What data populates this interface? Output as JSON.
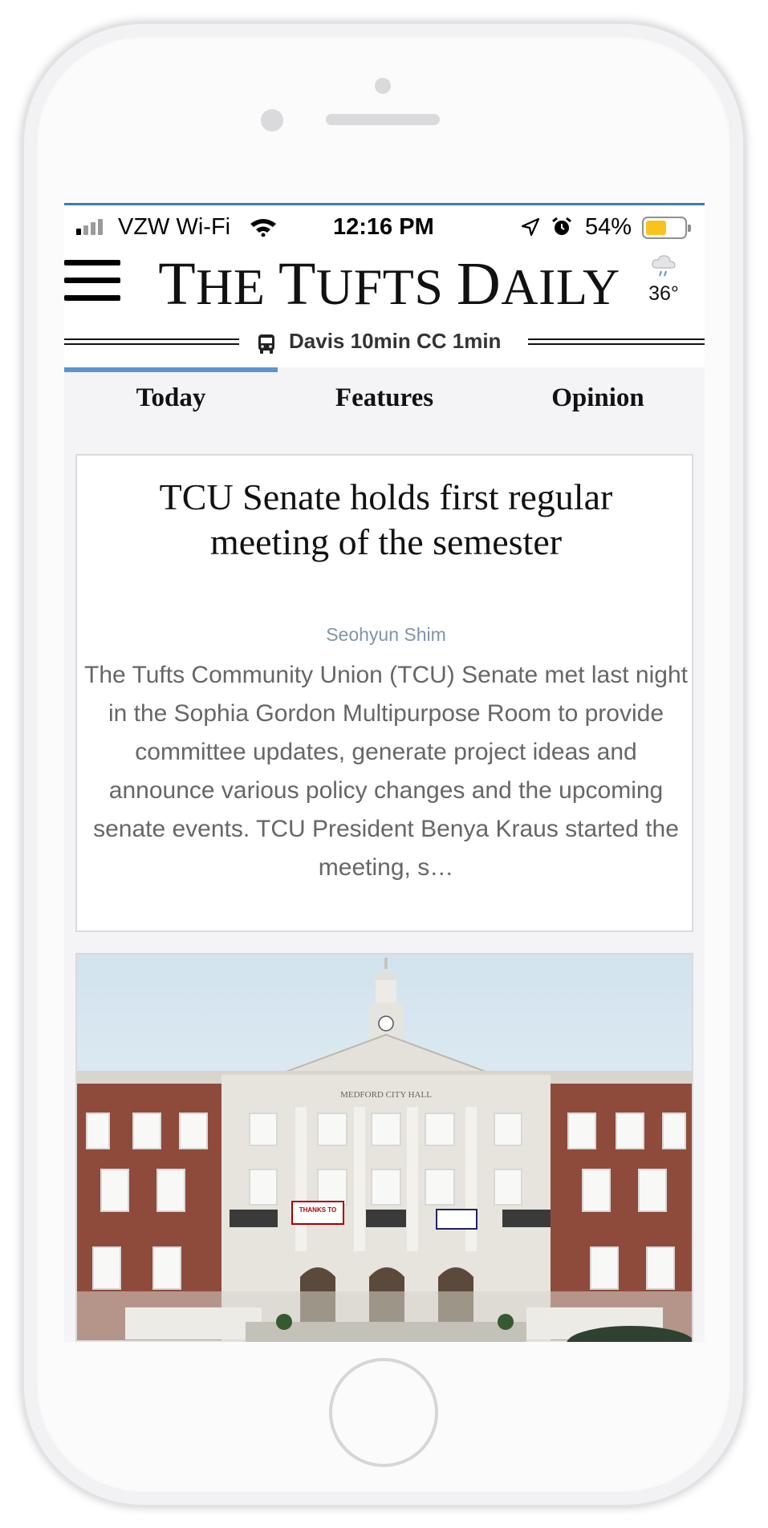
{
  "status_bar": {
    "carrier": "VZW Wi-Fi",
    "time": "12:16 PM",
    "battery_percent": "54%",
    "battery_level": 0.54,
    "battery_color": "#f8c31c",
    "icons": [
      "signal-icon",
      "wifi-icon",
      "location-arrow-icon",
      "alarm-clock-icon",
      "battery-icon"
    ]
  },
  "header": {
    "masthead": "THE TUFTS DAILY",
    "temperature": "36°",
    "weather_icon": "rain-cloud-icon",
    "menu_icon": "hamburger-menu-icon"
  },
  "shuttle": {
    "icon": "bus-icon",
    "text": "Davis 10min CC 1min"
  },
  "tabs": [
    {
      "label": "Today",
      "active": true
    },
    {
      "label": "Features",
      "active": false
    },
    {
      "label": "Opinion",
      "active": false
    }
  ],
  "colors": {
    "accent": "#5d94cf",
    "byline": "#8094a8",
    "excerpt": "#666666"
  },
  "article": {
    "title": "TCU Senate holds first regular meeting of the semester",
    "author": "Seohyun Shim",
    "excerpt": "The Tufts Community Union (TCU) Senate met last night in the Sophia Gordon Multipurpose Room to provide committee updates, generate project ideas and announce various policy changes and the upcoming senate events. TCU President Benya Kraus started the meeting, s…"
  },
  "image_card": {
    "sign_text": "MEDFORD CITY HALL",
    "banner_text": "THANKS TO"
  }
}
